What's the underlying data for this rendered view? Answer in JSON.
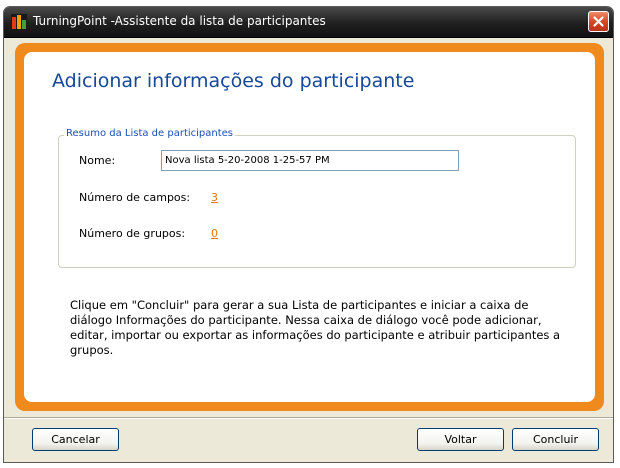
{
  "window": {
    "title": "TurningPoint -Assistente da lista de participantes"
  },
  "header": {
    "heading": "Adicionar informações do participante"
  },
  "summary": {
    "legend": "Resumo da Lista de participantes",
    "name_label": "Nome:",
    "name_value": "Nova lista 5-20-2008 1-25-57 PM",
    "fields_label": "Número de campos:",
    "fields_count": "3",
    "groups_label": "Número de grupos:",
    "groups_count": "0"
  },
  "description": "Clique em \"Concluir\" para gerar a sua Lista de participantes e iniciar a caixa de diálogo Informações do participante.  Nessa caixa de diálogo você pode adicionar, editar, importar ou exportar as informações do participante e atribuir participantes a grupos.",
  "buttons": {
    "cancel": "Cancelar",
    "back": "Voltar",
    "finish": "Concluir"
  },
  "colors": {
    "accent_orange": "#f08a1c",
    "heading_blue": "#17489a",
    "link_orange": "#e07a10"
  },
  "icons": {
    "app": "turningpoint-app-icon",
    "close": "close-icon"
  }
}
